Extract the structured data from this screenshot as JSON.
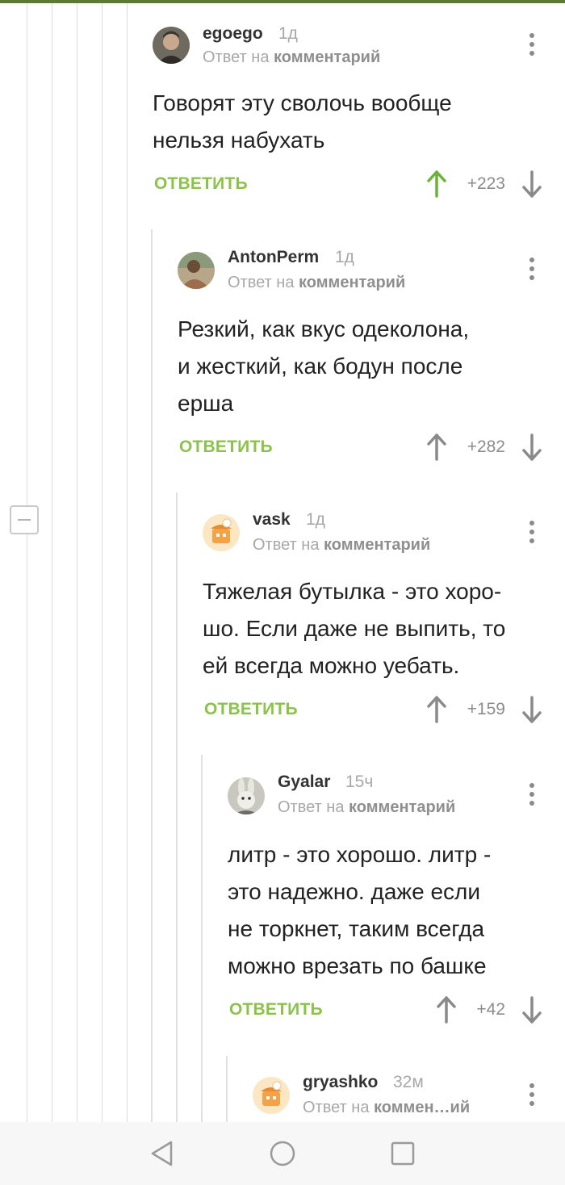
{
  "comments": [
    {
      "author": "egoego",
      "time": "1д",
      "reply_prefix": "Ответ на",
      "reply_target": "комментарий",
      "lines": [
        "Говорят эту сволочь вообще",
        "нельзя набухать"
      ],
      "reply_label": "ОТВЕТИТЬ",
      "score": "+223",
      "upvoted": true
    },
    {
      "author": "AntonPerm",
      "time": "1д",
      "reply_prefix": "Ответ на",
      "reply_target": "комментарий",
      "lines": [
        "Резкий, как вкус одеколона,",
        "и жесткий, как бодун после",
        "ерша"
      ],
      "reply_label": "ОТВЕТИТЬ",
      "score": "+282",
      "upvoted": false
    },
    {
      "author": "vask",
      "time": "1д",
      "reply_prefix": "Ответ на",
      "reply_target": "комментарий",
      "lines": [
        "Тяжелая бутылка - это хоро-",
        "шо. Если даже не выпить, то",
        "ей всегда можно уебать."
      ],
      "reply_label": "ОТВЕТИТЬ",
      "score": "+159",
      "upvoted": false
    },
    {
      "author": "Gyalar",
      "time": "15ч",
      "reply_prefix": "Ответ на",
      "reply_target": "комментарий",
      "lines": [
        "литр - это хорошо. литр -",
        "это надежно. даже если",
        "не торкнет, таким всегда",
        "можно врезать по башке"
      ],
      "reply_label": "ОТВЕТИТЬ",
      "score": "+42",
      "upvoted": false
    },
    {
      "author": "gryashko",
      "time": "32м",
      "reply_prefix": "Ответ на",
      "reply_target": "коммен…ий",
      "lines": [],
      "reply_label": "",
      "score": "",
      "upvoted": false
    }
  ],
  "colors": {
    "accent": "#8bc34a",
    "upvote_active": "#6bb33a",
    "arrow_inactive": "#8a8a8a",
    "topbar": "#5a7a35"
  },
  "icons": {
    "more": "vertical-dots-icon",
    "up": "arrow-up-icon",
    "down": "arrow-down-icon",
    "collapse": "minus-icon",
    "nav_back": "triangle-back-icon",
    "nav_home": "circle-home-icon",
    "nav_recent": "square-recent-icon"
  }
}
